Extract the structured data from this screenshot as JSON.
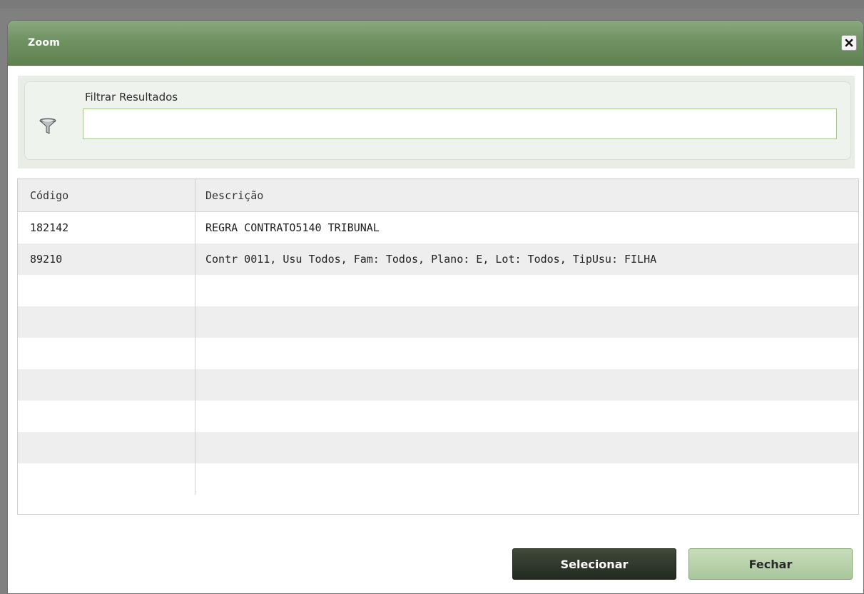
{
  "dialog": {
    "title": "Zoom",
    "close_icon": "close-x-icon"
  },
  "filter": {
    "label": "Filtrar Resultados",
    "icon": "funnel-filter-icon",
    "value": "",
    "placeholder": ""
  },
  "table": {
    "columns": [
      "Código",
      "Descrição"
    ],
    "rows": [
      {
        "codigo": "182142",
        "descricao": "REGRA CONTRATO5140 TRIBUNAL"
      },
      {
        "codigo": "89210",
        "descricao": "Contr 0011, Usu Todos, Fam: Todos, Plano: E, Lot: Todos, TipUsu: FILHA"
      },
      {
        "codigo": "",
        "descricao": ""
      },
      {
        "codigo": "",
        "descricao": ""
      },
      {
        "codigo": "",
        "descricao": ""
      },
      {
        "codigo": "",
        "descricao": ""
      },
      {
        "codigo": "",
        "descricao": ""
      },
      {
        "codigo": "",
        "descricao": ""
      },
      {
        "codigo": "",
        "descricao": ""
      }
    ]
  },
  "buttons": {
    "select_label": "Selecionar",
    "close_label": "Fechar"
  },
  "colors": {
    "titlebar": "#6f9262",
    "primary_button": "#2b3327",
    "secondary_button": "#b7d1aa"
  }
}
